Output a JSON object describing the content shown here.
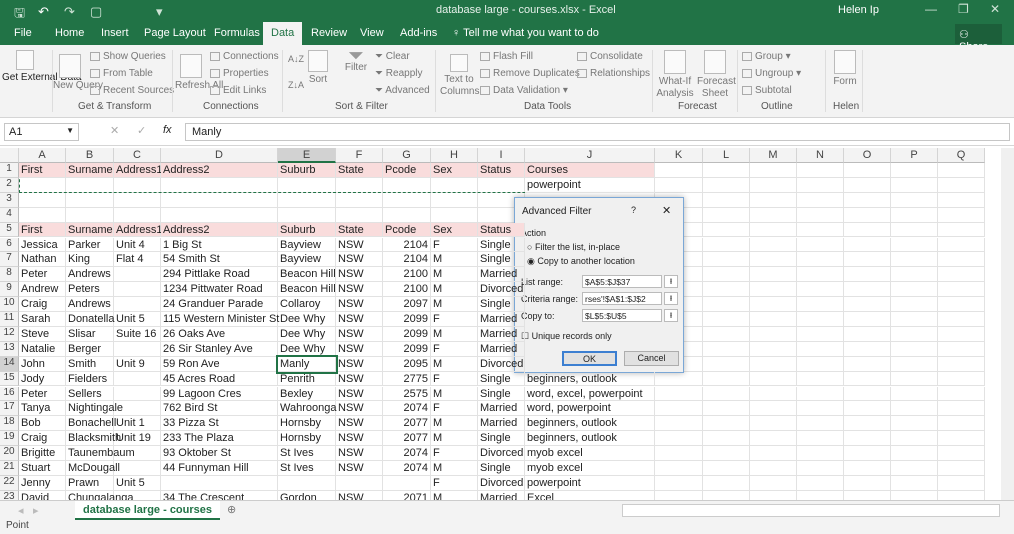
{
  "window": {
    "title": "database large - courses.xlsx  -  Excel",
    "user": "Helen Ip",
    "share": "Share"
  },
  "tabs": [
    "File",
    "Home",
    "Insert",
    "Page Layout",
    "Formulas",
    "Data",
    "Review",
    "View",
    "Add-ins"
  ],
  "tell_me": "Tell me what you want to do",
  "ribbon": {
    "get_external": "Get External Data",
    "new_query": "New Query",
    "show_queries": "Show Queries",
    "from_table": "From Table",
    "recent_sources": "Recent Sources",
    "refresh_all": "Refresh All",
    "connections": "Connections",
    "properties": "Properties",
    "edit_links": "Edit Links",
    "sort": "Sort",
    "filter": "Filter",
    "clear": "Clear",
    "reapply": "Reapply",
    "advanced": "Advanced",
    "text_to_columns": "Text to Columns",
    "flash_fill": "Flash Fill",
    "remove_duplicates": "Remove Duplicates",
    "data_validation": "Data Validation",
    "consolidate": "Consolidate",
    "relationships": "Relationships",
    "what_if": "What-If Analysis",
    "forecast_sheet": "Forecast Sheet",
    "group": "Group",
    "ungroup": "Ungroup",
    "subtotal": "Subtotal",
    "form": "Form",
    "groups": [
      "Get & Transform",
      "Connections",
      "Sort & Filter",
      "Data Tools",
      "Forecast",
      "Outline",
      "Helen"
    ]
  },
  "formula_bar": {
    "name_box": "A1",
    "fx": "fx",
    "value": "Manly"
  },
  "columns": [
    "A",
    "B",
    "C",
    "D",
    "E",
    "F",
    "G",
    "H",
    "I",
    "J",
    "K",
    "L",
    "M",
    "N",
    "O",
    "P",
    "Q"
  ],
  "rows": [
    [
      "First",
      "Surname",
      "Address1",
      "Address2",
      "Suburb",
      "State",
      "Pcode",
      "Sex",
      "Status",
      "Courses"
    ],
    [
      "",
      "",
      "",
      "",
      "",
      "",
      "",
      "",
      "",
      "powerpoint"
    ],
    [],
    [],
    [
      "First",
      "Surname",
      "Address1",
      "Address2",
      "Suburb",
      "State",
      "Pcode",
      "Sex",
      "Status"
    ],
    [
      "Jessica",
      "Parker",
      "Unit 4",
      "1 Big St",
      "Bayview",
      "NSW",
      "2104",
      "F",
      "Single"
    ],
    [
      "Nathan",
      "King",
      "Flat 4",
      "54 Smith St",
      "Bayview",
      "NSW",
      "2104",
      "M",
      "Single"
    ],
    [
      "Peter",
      "Andrews",
      "",
      "294 Pittlake Road",
      "Beacon Hill",
      "NSW",
      "2100",
      "M",
      "Married"
    ],
    [
      "Andrew",
      "Peters",
      "",
      "1234 Pittwater Road",
      "Beacon Hill",
      "NSW",
      "2100",
      "M",
      "Divorced"
    ],
    [
      "Craig",
      "Andrews",
      "",
      "24 Granduer Parade",
      "Collaroy",
      "NSW",
      "2097",
      "M",
      "Single"
    ],
    [
      "Sarah",
      "Donatella",
      "Unit 5",
      "115 Western Minister St",
      "Dee Why",
      "NSW",
      "2099",
      "F",
      "Married"
    ],
    [
      "Steve",
      "Slisar",
      "Suite 16",
      "26 Oaks Ave",
      "Dee Why",
      "NSW",
      "2099",
      "M",
      "Married"
    ],
    [
      "Natalie",
      "Berger",
      "",
      "26 Sir Stanley Ave",
      "Dee Why",
      "NSW",
      "2099",
      "F",
      "Married"
    ],
    [
      "John",
      "Smith",
      "Unit 9",
      "59 Ron Ave",
      "Manly",
      "NSW",
      "2095",
      "M",
      "Divorced"
    ],
    [
      "Jody",
      "Fielders",
      "",
      "45 Acres Road",
      "Penrith",
      "NSW",
      "2775",
      "F",
      "Single",
      "beginners, outlook"
    ],
    [
      "Peter",
      "Sellers",
      "",
      "99 Lagoon Cres",
      "Bexley",
      "NSW",
      "2575",
      "M",
      "Single",
      "word, excel, powerpoint"
    ],
    [
      "Tanya",
      "Nightingale",
      "",
      "762 Bird St",
      "Wahroonga",
      "NSW",
      "2074",
      "F",
      "Married",
      "word, powerpoint"
    ],
    [
      "Bob",
      "Bonachell",
      "Unit 1",
      "33 Pizza St",
      "Hornsby",
      "NSW",
      "2077",
      "M",
      "Married",
      "beginners, outlook"
    ],
    [
      "Craig",
      "Blacksmith",
      "Unit 19",
      "233 The Plaza",
      "Hornsby",
      "NSW",
      "2077",
      "M",
      "Single",
      "beginners, outlook"
    ],
    [
      "Brigitte",
      "Taunembaum",
      "",
      "93 Oktober St",
      "St Ives",
      "NSW",
      "2074",
      "F",
      "Divorced",
      "myob excel"
    ],
    [
      "Stuart",
      "McDougall",
      "",
      "44 Funnyman Hill",
      "St Ives",
      "NSW",
      "2074",
      "M",
      "Single",
      "myob excel"
    ],
    [
      "Jenny",
      "Prawn",
      "Unit 5",
      "",
      "",
      "",
      "",
      "F",
      "Divorced",
      "powerpoint"
    ],
    [
      "David",
      "Chungalanga",
      "",
      "34 The Crescent",
      "Gordon",
      "NSW",
      "2071",
      "M",
      "Married",
      "Excel"
    ]
  ],
  "dialog": {
    "title": "Advanced Filter",
    "help": "?",
    "close": "✕",
    "action": "Action",
    "opt_filter": "Filter the list, in-place",
    "opt_copy": "Copy to another location",
    "list_label": "List range:",
    "list_value": "$A$5:$J$37",
    "criteria_label": "Criteria range:",
    "criteria_value": "rses'!$A$1:$J$2",
    "copy_label": "Copy to:",
    "copy_value": "$L$5:$U$5",
    "unique": "Unique records only",
    "ok": "OK",
    "cancel": "Cancel"
  },
  "sheet_tab": "database large - courses",
  "status": "Point"
}
